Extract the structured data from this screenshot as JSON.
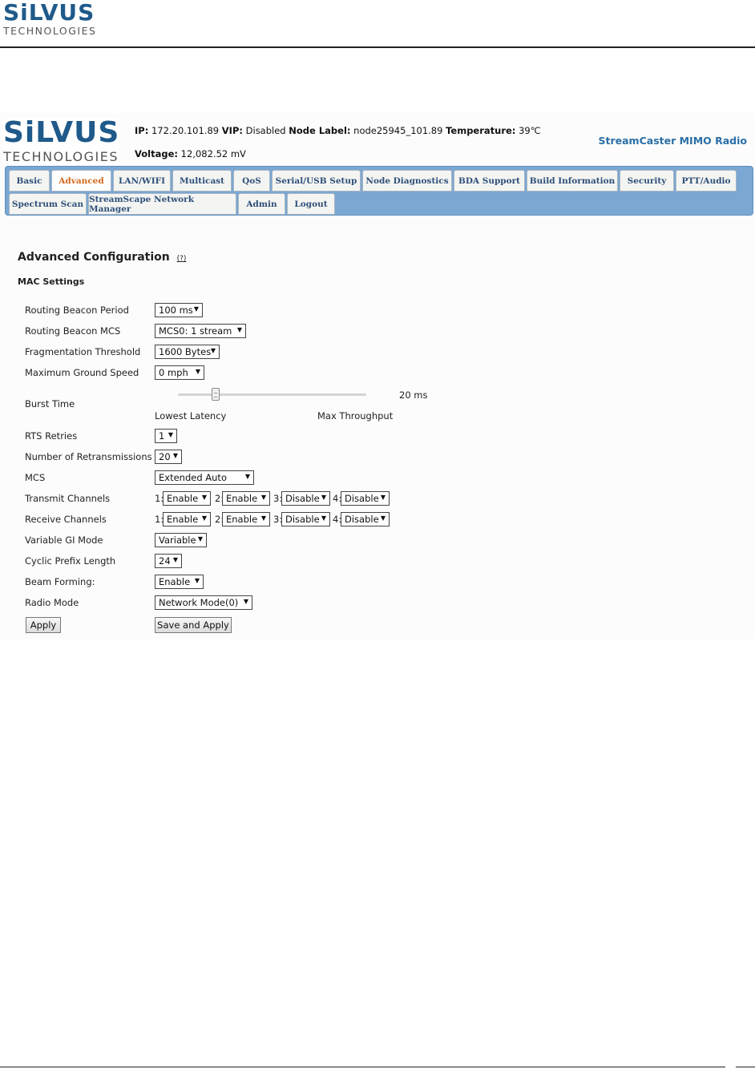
{
  "doc": {
    "logo_word": "SiLVUS",
    "logo_sub": "TECHNOLOGIES"
  },
  "header": {
    "logo_word": "SiLVUS",
    "logo_sub": "TECHNOLOGIES",
    "ip_label": "IP:",
    "ip_value": "172.20.101.89",
    "vip_label": "VIP:",
    "vip_value": "Disabled",
    "node_label_label": "Node Label:",
    "node_label_value": "node25945_101.89",
    "temperature_label": "Temperature:",
    "temperature_value": "39℃",
    "voltage_label": "Voltage:",
    "voltage_value": "12,082.52 mV",
    "product_name": "StreamCaster MIMO Radio"
  },
  "tabs": {
    "row1": [
      "Basic",
      "Advanced",
      "LAN/WIFI",
      "Multicast",
      "QoS",
      "Serial/USB Setup",
      "Node Diagnostics",
      "BDA Support",
      "Build Information",
      "Security",
      "PTT/Audio"
    ],
    "row2": [
      "Spectrum Scan",
      "StreamScape Network Manager",
      "Admin",
      "Logout"
    ],
    "active": "Advanced"
  },
  "page": {
    "title": "Advanced Configuration",
    "help_link": "(?)",
    "subsection": "MAC Settings"
  },
  "form": {
    "routing_beacon_period": {
      "label": "Routing Beacon Period",
      "value": "100 ms"
    },
    "routing_beacon_mcs": {
      "label": "Routing Beacon MCS",
      "value": "MCS0: 1 stream"
    },
    "fragmentation_threshold": {
      "label": "Fragmentation Threshold",
      "value": "1600 Bytes"
    },
    "max_ground_speed": {
      "label": "Maximum Ground Speed",
      "value": "0 mph"
    },
    "burst_time": {
      "label": "Burst Time",
      "value_text": "20 ms",
      "min_label": "Lowest Latency",
      "max_label": "Max Throughput",
      "level": 0.2
    },
    "rts_retries": {
      "label": "RTS Retries",
      "value": "1"
    },
    "retransmissions": {
      "label": "Number of Retransmissions",
      "value": "20"
    },
    "mcs": {
      "label": "MCS",
      "value": "Extended Auto"
    },
    "transmit_channels": {
      "label": "Transmit Channels",
      "channels": [
        {
          "num": "1:",
          "value": "Enable"
        },
        {
          "num": "2:",
          "value": "Enable"
        },
        {
          "num": "3:",
          "value": "Disable"
        },
        {
          "num": "4:",
          "value": "Disable"
        }
      ]
    },
    "receive_channels": {
      "label": "Receive Channels",
      "channels": [
        {
          "num": "1:",
          "value": "Enable"
        },
        {
          "num": "2:",
          "value": "Enable"
        },
        {
          "num": "3:",
          "value": "Disable"
        },
        {
          "num": "4:",
          "value": "Disable"
        }
      ]
    },
    "variable_gi_mode": {
      "label": "Variable GI Mode",
      "value": "Variable"
    },
    "cyclic_prefix_length": {
      "label": "Cyclic Prefix Length",
      "value": "24"
    },
    "beam_forming": {
      "label": "Beam Forming:",
      "value": "Enable"
    },
    "radio_mode": {
      "label": "Radio Mode",
      "value": "Network Mode(0)"
    }
  },
  "buttons": {
    "apply": "Apply",
    "save_and_apply": "Save and Apply"
  },
  "colors": {
    "brand_blue": "#1f5a8a",
    "tabbar": "#7ba7d2",
    "active_tab_text": "#d2691e",
    "product_text": "#2a6fa8"
  }
}
